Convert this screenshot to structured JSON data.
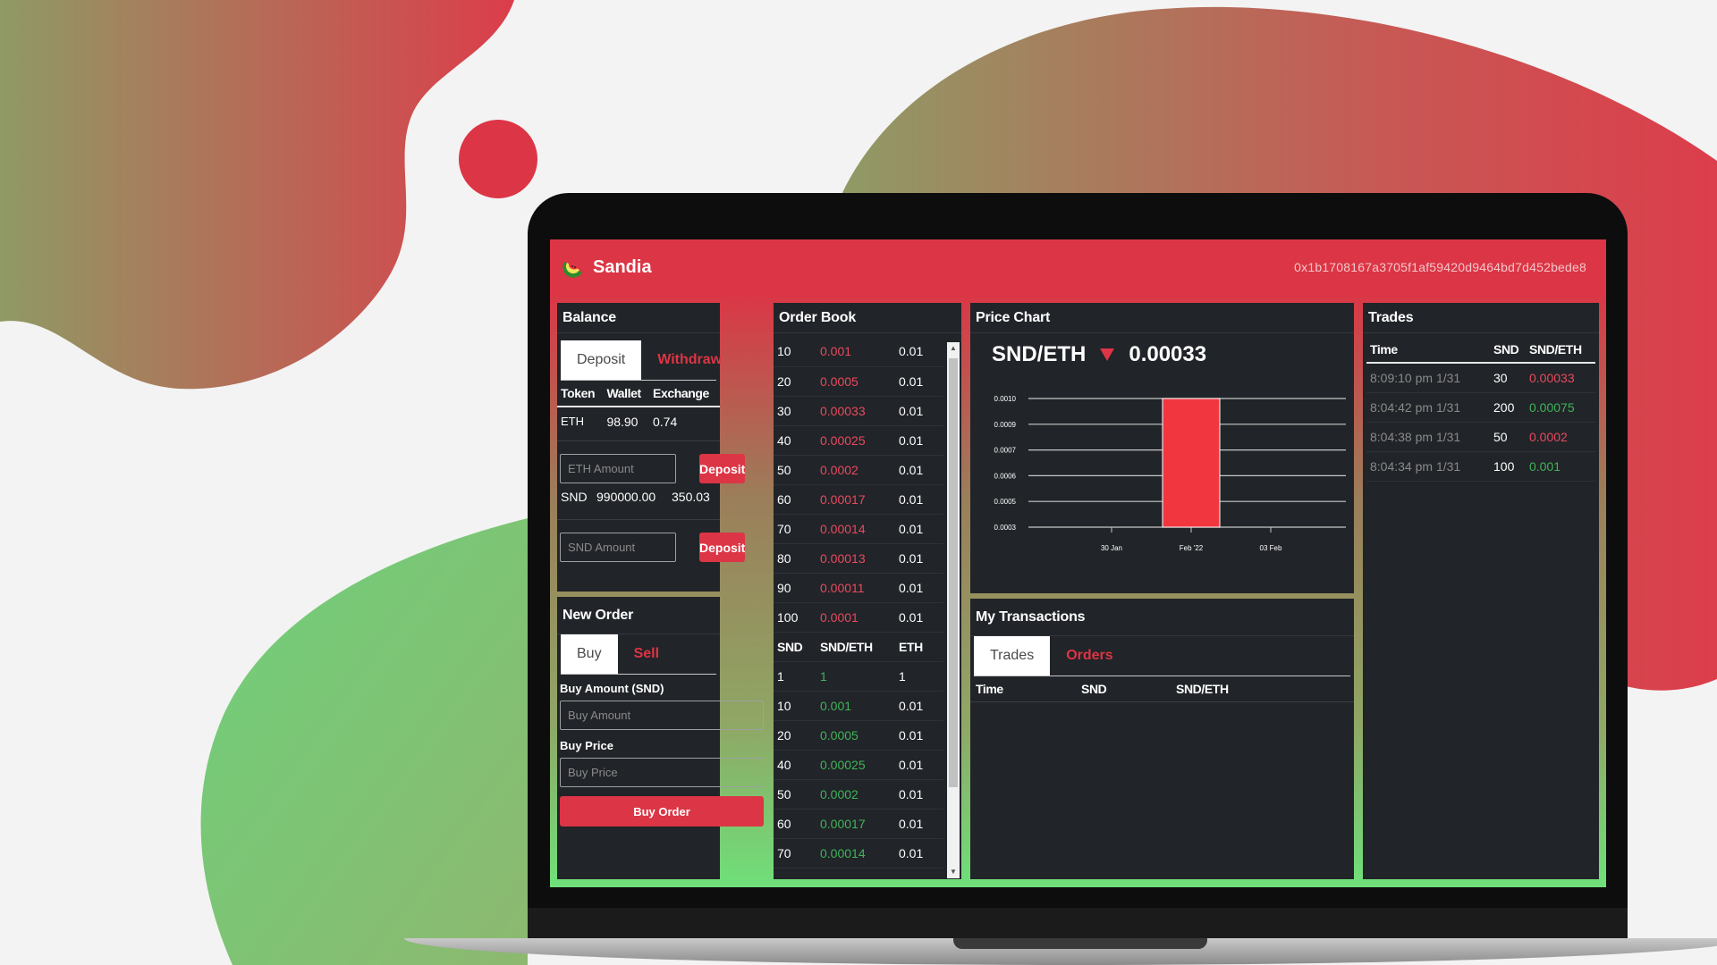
{
  "app": {
    "brand": "Sandia",
    "wallet_address": "0x1b1708167a3705f1af59420d9464bd7d452bede8"
  },
  "balance": {
    "title": "Balance",
    "tabs": [
      "Deposit",
      "Withdraw"
    ],
    "headers": [
      "Token",
      "Wallet",
      "Exchange"
    ],
    "eth": {
      "token": "ETH",
      "wallet": "98.90",
      "exchange": "0.74",
      "placeholder": "ETH Amount",
      "button": "Deposit"
    },
    "snd": {
      "token": "SND",
      "wallet": "990000.00",
      "exchange": "350.03",
      "placeholder": "SND Amount",
      "button": "Deposit"
    }
  },
  "new_order": {
    "title": "New Order",
    "tabs": [
      "Buy",
      "Sell"
    ],
    "amount_label": "Buy Amount (SND)",
    "amount_placeholder": "Buy Amount",
    "price_label": "Buy Price",
    "price_placeholder": "Buy Price",
    "submit": "Buy Order"
  },
  "order_book": {
    "title": "Order Book",
    "sell_orders": [
      [
        "10",
        "0.001",
        "0.01"
      ],
      [
        "20",
        "0.0005",
        "0.01"
      ],
      [
        "30",
        "0.00033",
        "0.01"
      ],
      [
        "40",
        "0.00025",
        "0.01"
      ],
      [
        "50",
        "0.0002",
        "0.01"
      ],
      [
        "60",
        "0.00017",
        "0.01"
      ],
      [
        "70",
        "0.00014",
        "0.01"
      ],
      [
        "80",
        "0.00013",
        "0.01"
      ],
      [
        "90",
        "0.00011",
        "0.01"
      ],
      [
        "100",
        "0.0001",
        "0.01"
      ]
    ],
    "headers": [
      "SND",
      "SND/ETH",
      "ETH"
    ],
    "buy_orders": [
      [
        "1",
        "1",
        "1"
      ],
      [
        "10",
        "0.001",
        "0.01"
      ],
      [
        "20",
        "0.0005",
        "0.01"
      ],
      [
        "40",
        "0.00025",
        "0.01"
      ],
      [
        "50",
        "0.0002",
        "0.01"
      ],
      [
        "60",
        "0.00017",
        "0.01"
      ],
      [
        "70",
        "0.00014",
        "0.01"
      ]
    ]
  },
  "price_chart": {
    "title": "Price Chart",
    "pair": "SND/ETH",
    "price": "0.00033",
    "direction_icon": "triangle-down-icon",
    "y_ticks": [
      "0.0010",
      "0.0009",
      "0.0007",
      "0.0006",
      "0.0005",
      "0.0003"
    ],
    "x_ticks": [
      "30 Jan",
      "Feb '22",
      "03 Feb"
    ]
  },
  "chart_data": {
    "type": "bar",
    "categories": [
      "30 Jan",
      "Feb '22",
      "03 Feb"
    ],
    "values": [
      null,
      0.001,
      null
    ],
    "low": [
      null,
      0.0003,
      null
    ],
    "ylim": [
      0.0003,
      0.001
    ],
    "grid": true,
    "title": "",
    "xlabel": "",
    "ylabel": ""
  },
  "my_transactions": {
    "title": "My Transactions",
    "tabs": [
      "Trades",
      "Orders"
    ],
    "headers": [
      "Time",
      "SND",
      "SND/ETH"
    ]
  },
  "trades": {
    "title": "Trades",
    "headers": [
      "Time",
      "SND",
      "SND/ETH"
    ],
    "rows": [
      {
        "time": "8:09:10 pm 1/31",
        "snd": "30",
        "price": "0.00033",
        "color": "red"
      },
      {
        "time": "8:04:42 pm 1/31",
        "snd": "200",
        "price": "0.00075",
        "color": "green"
      },
      {
        "time": "8:04:38 pm 1/31",
        "snd": "50",
        "price": "0.0002",
        "color": "red"
      },
      {
        "time": "8:04:34 pm 1/31",
        "snd": "100",
        "price": "0.001",
        "color": "green"
      }
    ]
  },
  "colors": {
    "brand_red": "#dc3545",
    "sell_red": "#e84a5f",
    "buy_green": "#3fb55a",
    "panel": "#212428"
  }
}
